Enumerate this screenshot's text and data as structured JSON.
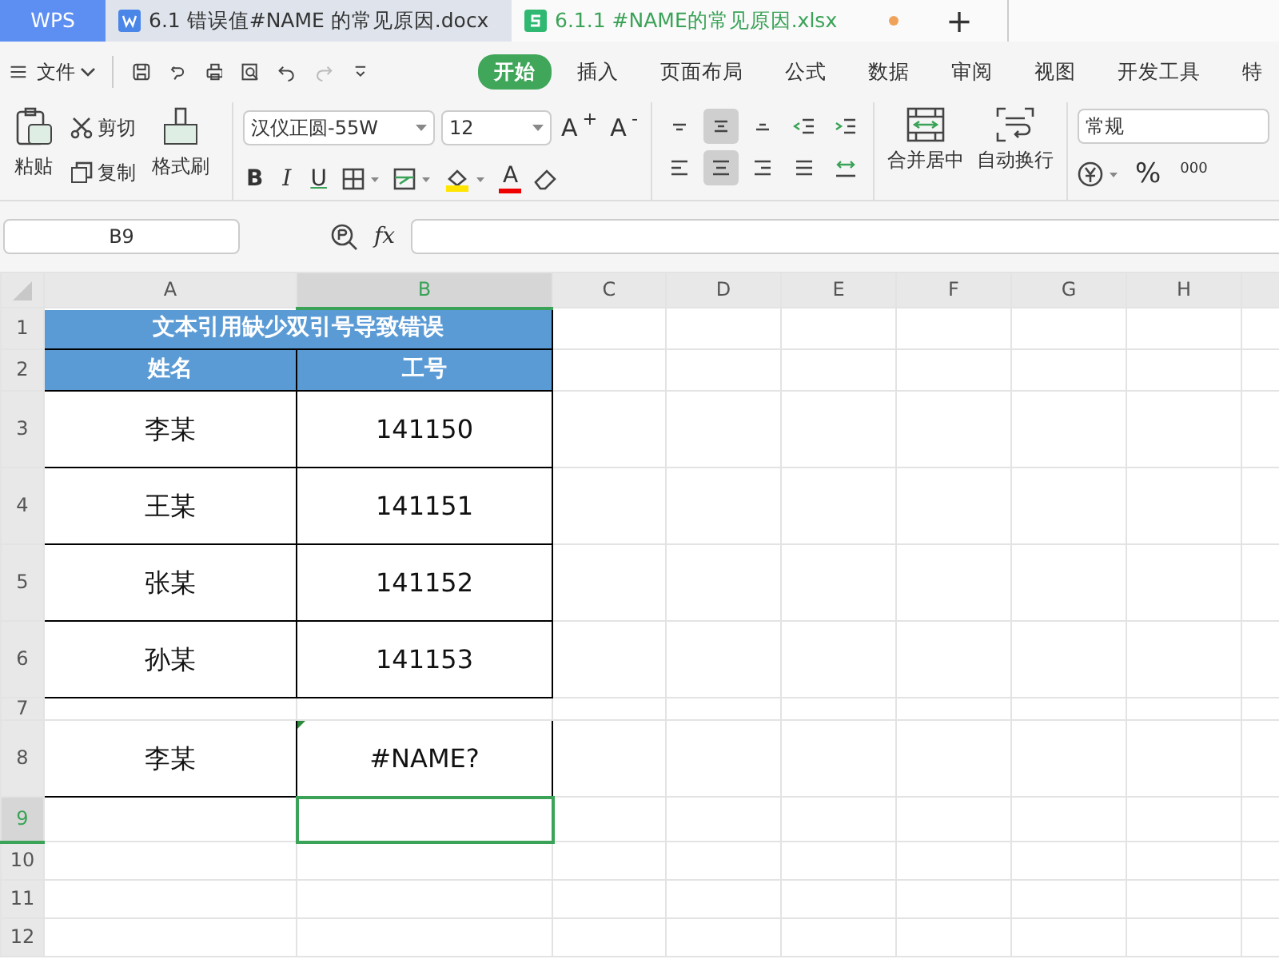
{
  "tabs": [
    {
      "label": "WPS",
      "kind": "home",
      "selected": false,
      "modified": false
    },
    {
      "label": "6.1 错误值#NAME 的常见原因.docx",
      "kind": "doc",
      "selected": false,
      "modified": false
    },
    {
      "label": "6.1.1 #NAME的常见原因.xlsx",
      "kind": "sheet",
      "selected": true,
      "modified": true
    }
  ],
  "new_tab": "+",
  "menu": {
    "file": "文件",
    "items": [
      {
        "label": "开始",
        "selected": true
      },
      {
        "label": "插入",
        "selected": false
      },
      {
        "label": "页面布局",
        "selected": false
      },
      {
        "label": "公式",
        "selected": false
      },
      {
        "label": "数据",
        "selected": false
      },
      {
        "label": "审阅",
        "selected": false
      },
      {
        "label": "视图",
        "selected": false
      },
      {
        "label": "开发工具",
        "selected": false
      },
      {
        "label": "特",
        "selected": false
      }
    ]
  },
  "ribbon": {
    "paste": "粘贴",
    "cut": "剪切",
    "copy": "复制",
    "format_painter": "格式刷",
    "font_name": "汉仪正圆-55W",
    "font_size": "12",
    "grow": "A$^{+}$",
    "shrink": "A$^{-}$",
    "bold": "B",
    "italic": "I",
    "underline": "U",
    "font_color": "A",
    "align_top": [
      {
        "kind": "top",
        "selected": false
      },
      {
        "kind": "middle",
        "selected": true
      },
      {
        "kind": "bottom",
        "selected": false
      },
      {
        "kind": "outdent",
        "selected": false
      },
      {
        "kind": "indent",
        "selected": false
      }
    ],
    "align_bottom": [
      {
        "kind": "left",
        "selected": false
      },
      {
        "kind": "center",
        "selected": true
      },
      {
        "kind": "right",
        "selected": false
      },
      {
        "kind": "justify",
        "selected": false
      },
      {
        "kind": "distribute",
        "selected": false
      }
    ],
    "merge": "合并居中",
    "wrap": "自动换行",
    "number_format": "常规",
    "percent": "%",
    "thousands": "000"
  },
  "formula_bar": {
    "name_box": "B9",
    "fx": "fx"
  },
  "columns": [
    {
      "label": "A",
      "selected": false
    },
    {
      "label": "B",
      "selected": true
    },
    {
      "label": "C",
      "selected": false
    },
    {
      "label": "D",
      "selected": false
    },
    {
      "label": "E",
      "selected": false
    },
    {
      "label": "F",
      "selected": false
    },
    {
      "label": "G",
      "selected": false
    },
    {
      "label": "H",
      "selected": false
    }
  ],
  "rows": [
    {
      "number": "1",
      "kind": "title",
      "selected": false,
      "cells": [
        {
          "text": "文本引用缺少双引号导致错误",
          "error": false
        }
      ]
    },
    {
      "number": "2",
      "kind": "header",
      "selected": false,
      "cells": [
        {
          "text": "姓名",
          "error": false
        },
        {
          "text": "工号",
          "error": false
        }
      ]
    },
    {
      "number": "3",
      "kind": "data",
      "selected": false,
      "cells": [
        {
          "text": "李某",
          "error": false
        },
        {
          "text": "141150",
          "error": false
        }
      ]
    },
    {
      "number": "4",
      "kind": "data",
      "selected": false,
      "cells": [
        {
          "text": "王某",
          "error": false
        },
        {
          "text": "141151",
          "error": false
        }
      ]
    },
    {
      "number": "5",
      "kind": "data",
      "selected": false,
      "cells": [
        {
          "text": "张某",
          "error": false
        },
        {
          "text": "141152",
          "error": false
        }
      ]
    },
    {
      "number": "6",
      "kind": "data",
      "selected": false,
      "cells": [
        {
          "text": "孙某",
          "error": false
        },
        {
          "text": "141153",
          "error": false
        }
      ]
    },
    {
      "number": "7",
      "kind": "gap",
      "selected": false,
      "cells": []
    },
    {
      "number": "8",
      "kind": "data",
      "selected": false,
      "cells": [
        {
          "text": "李某",
          "error": false
        },
        {
          "text": "#NAME?",
          "error": true
        }
      ]
    },
    {
      "number": "9",
      "kind": "blank",
      "selected": true,
      "cells": []
    },
    {
      "number": "10",
      "kind": "blank",
      "selected": false,
      "cells": []
    },
    {
      "number": "11",
      "kind": "blank",
      "selected": false,
      "cells": []
    },
    {
      "number": "12",
      "kind": "blank",
      "selected": false,
      "cells": []
    }
  ]
}
